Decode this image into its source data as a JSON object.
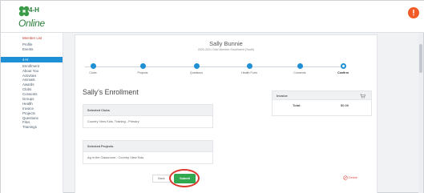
{
  "app": {
    "logo_h": "4-H",
    "logo_name": "Online"
  },
  "sidebar": {
    "member_list": "Member List",
    "items_top": [
      "Profile",
      "Events"
    ],
    "active": "4-H",
    "items": [
      "Enrollment",
      "About You",
      "Activities",
      "Animals",
      "Awards",
      "Clubs",
      "Consents",
      "Groups",
      "Health",
      "Invoice",
      "Projects",
      "Questions",
      "Files",
      "Trainings"
    ]
  },
  "main": {
    "student_name": "Sally Bunnie",
    "student_sub": "2020-2021 Club Member Enrollment (Youth)",
    "steps": [
      "Clubs",
      "Projects",
      "Questions",
      "Health Form",
      "Consents",
      "Confirm"
    ],
    "title": "Sally's Enrollment",
    "clubs_heading": "Selected Clubs",
    "clubs_value": "Country View Kids, Training - Primary",
    "projects_heading": "Selected Projects",
    "projects_value": "Ag in the Classroom - Country View Kids",
    "invoice_heading": "Invoice",
    "invoice_total_label": "Total:",
    "invoice_total_value": "$0.00",
    "back_label": "Back",
    "submit_label": "Submit",
    "delete_label": "Delete"
  },
  "colors": {
    "accent": "#1f8fd6",
    "submit": "#2fa84f",
    "alert": "#f25a27",
    "highlight": "#d9372b"
  },
  "icons": [
    "clover-icon",
    "alert-icon",
    "cart-icon",
    "delete-icon"
  ]
}
